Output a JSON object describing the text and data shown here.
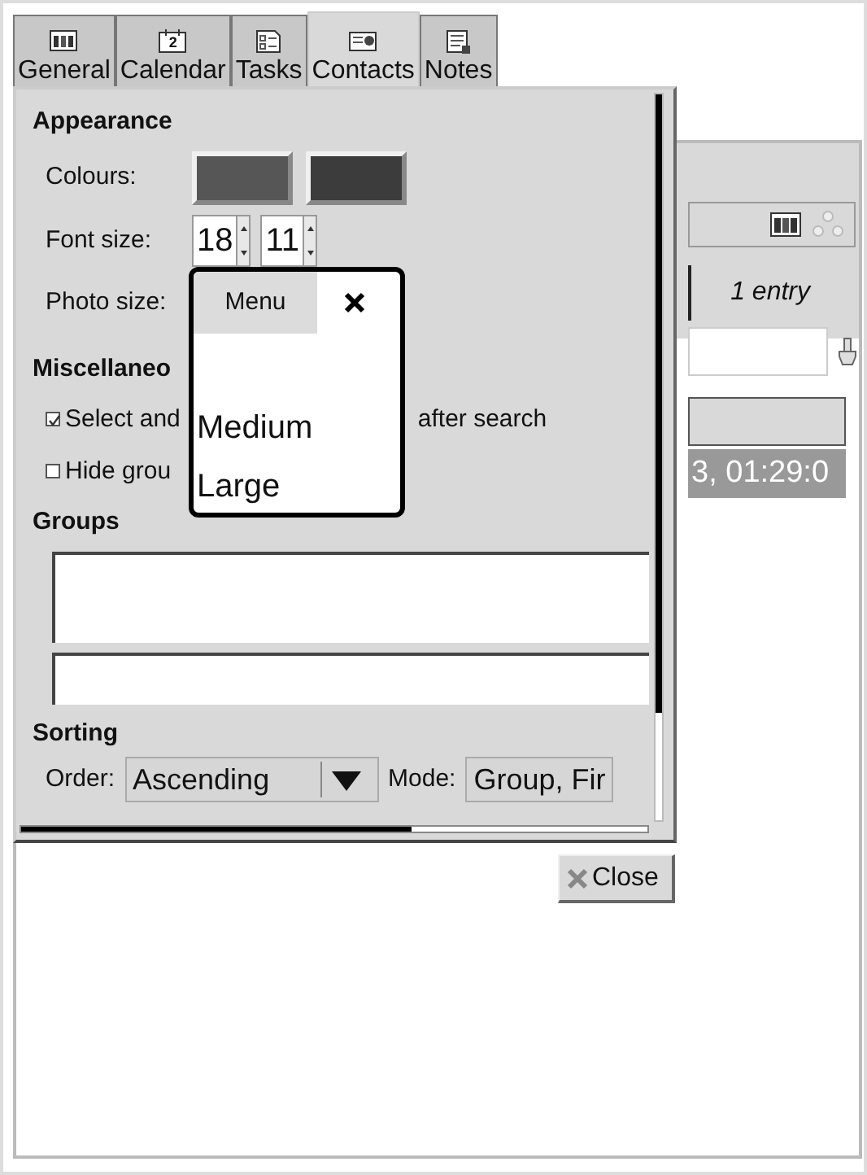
{
  "back_window": {
    "entry_count": "1 entry",
    "row_text": "3, 01:29:0"
  },
  "dialog": {
    "tabs": [
      {
        "label": "General",
        "selected": false
      },
      {
        "label": "Calendar",
        "icon_text": "2",
        "selected": false
      },
      {
        "label": "Tasks",
        "selected": false
      },
      {
        "label": "Contacts",
        "selected": true
      },
      {
        "label": "Notes",
        "selected": false
      }
    ],
    "appearance": {
      "heading": "Appearance",
      "colours_label": "Colours:",
      "colours": [
        {
          "color": "#565656"
        },
        {
          "color": "#3c3c3c"
        }
      ],
      "font_size_label": "Font size:",
      "font_sizes": [
        "18",
        "11"
      ],
      "photo_size_label": "Photo size:"
    },
    "miscellaneous": {
      "heading": "Miscellaneo",
      "options": [
        {
          "text": "Select and",
          "text_after": "after search",
          "checked": true
        },
        {
          "text": "Hide grou",
          "checked": false
        }
      ]
    },
    "groups": {
      "heading": "Groups"
    },
    "sorting": {
      "heading": "Sorting",
      "order_label": "Order:",
      "order_value": "Ascending",
      "mode_label": "Mode:",
      "mode_value": "Group, Fir"
    },
    "close_button": "Close"
  },
  "popup": {
    "title": "Menu",
    "items": [
      "Medium",
      "Large"
    ]
  }
}
